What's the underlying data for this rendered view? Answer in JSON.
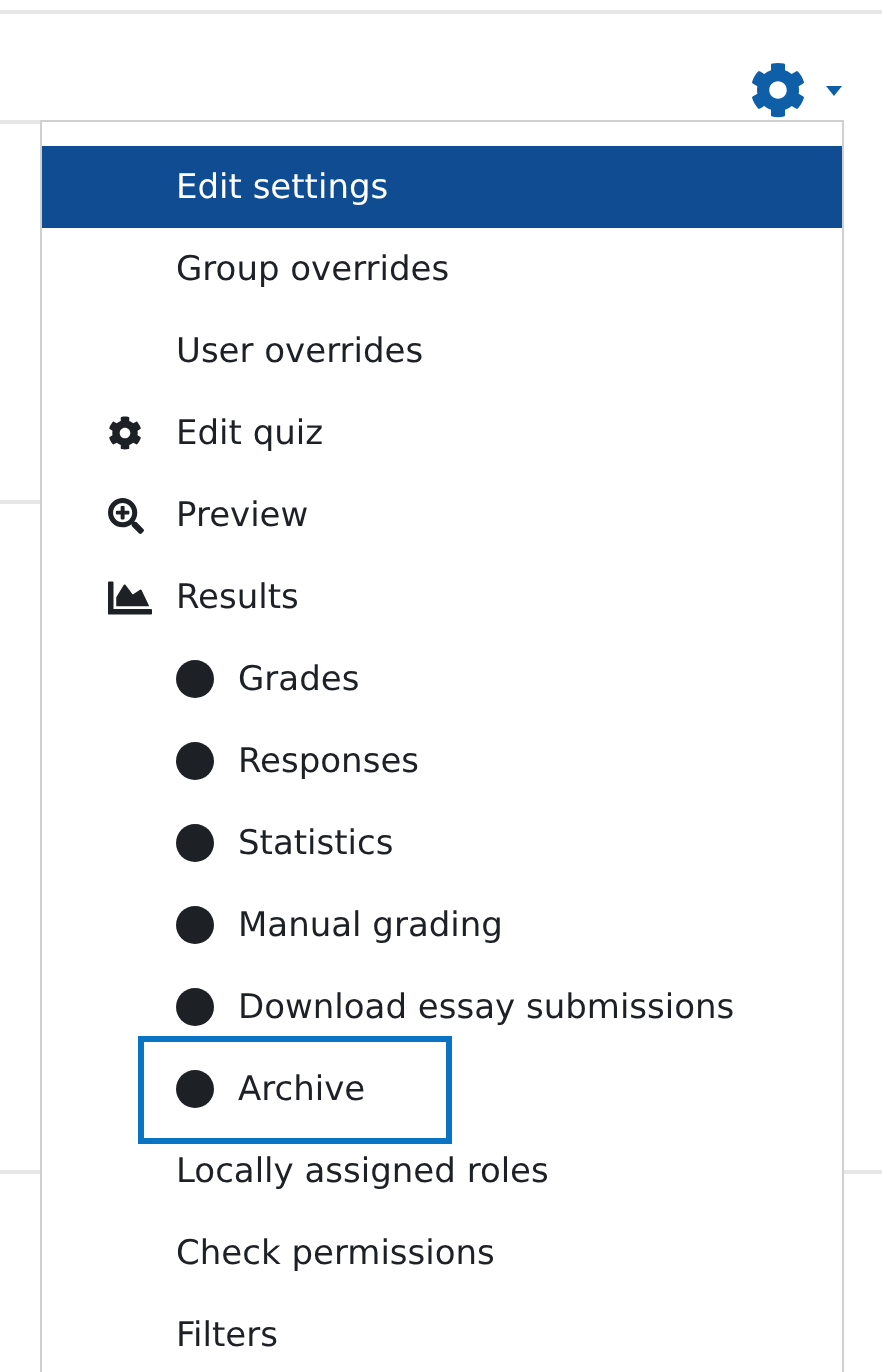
{
  "menu": {
    "items": [
      {
        "label": "Edit settings",
        "kind": "plain",
        "selected": true,
        "highlighted": false
      },
      {
        "label": "Group overrides",
        "kind": "plain",
        "selected": false,
        "highlighted": false
      },
      {
        "label": "User overrides",
        "kind": "plain",
        "selected": false,
        "highlighted": false
      },
      {
        "label": "Edit quiz",
        "kind": "gear",
        "selected": false,
        "highlighted": false
      },
      {
        "label": "Preview",
        "kind": "zoom",
        "selected": false,
        "highlighted": false
      },
      {
        "label": "Results",
        "kind": "chart",
        "selected": false,
        "highlighted": false,
        "children": [
          {
            "label": "Grades",
            "kind": "bullet",
            "selected": false,
            "highlighted": false
          },
          {
            "label": "Responses",
            "kind": "bullet",
            "selected": false,
            "highlighted": false
          },
          {
            "label": "Statistics",
            "kind": "bullet",
            "selected": false,
            "highlighted": false
          },
          {
            "label": "Manual grading",
            "kind": "bullet",
            "selected": false,
            "highlighted": false
          },
          {
            "label": "Download essay submissions",
            "kind": "bullet",
            "selected": false,
            "highlighted": false
          },
          {
            "label": "Archive",
            "kind": "bullet",
            "selected": false,
            "highlighted": true
          }
        ]
      },
      {
        "label": "Locally assigned roles",
        "kind": "plain",
        "selected": false,
        "highlighted": false
      },
      {
        "label": "Check permissions",
        "kind": "plain",
        "selected": false,
        "highlighted": false
      },
      {
        "label": "Filters",
        "kind": "plain",
        "selected": false,
        "highlighted": false
      }
    ]
  }
}
